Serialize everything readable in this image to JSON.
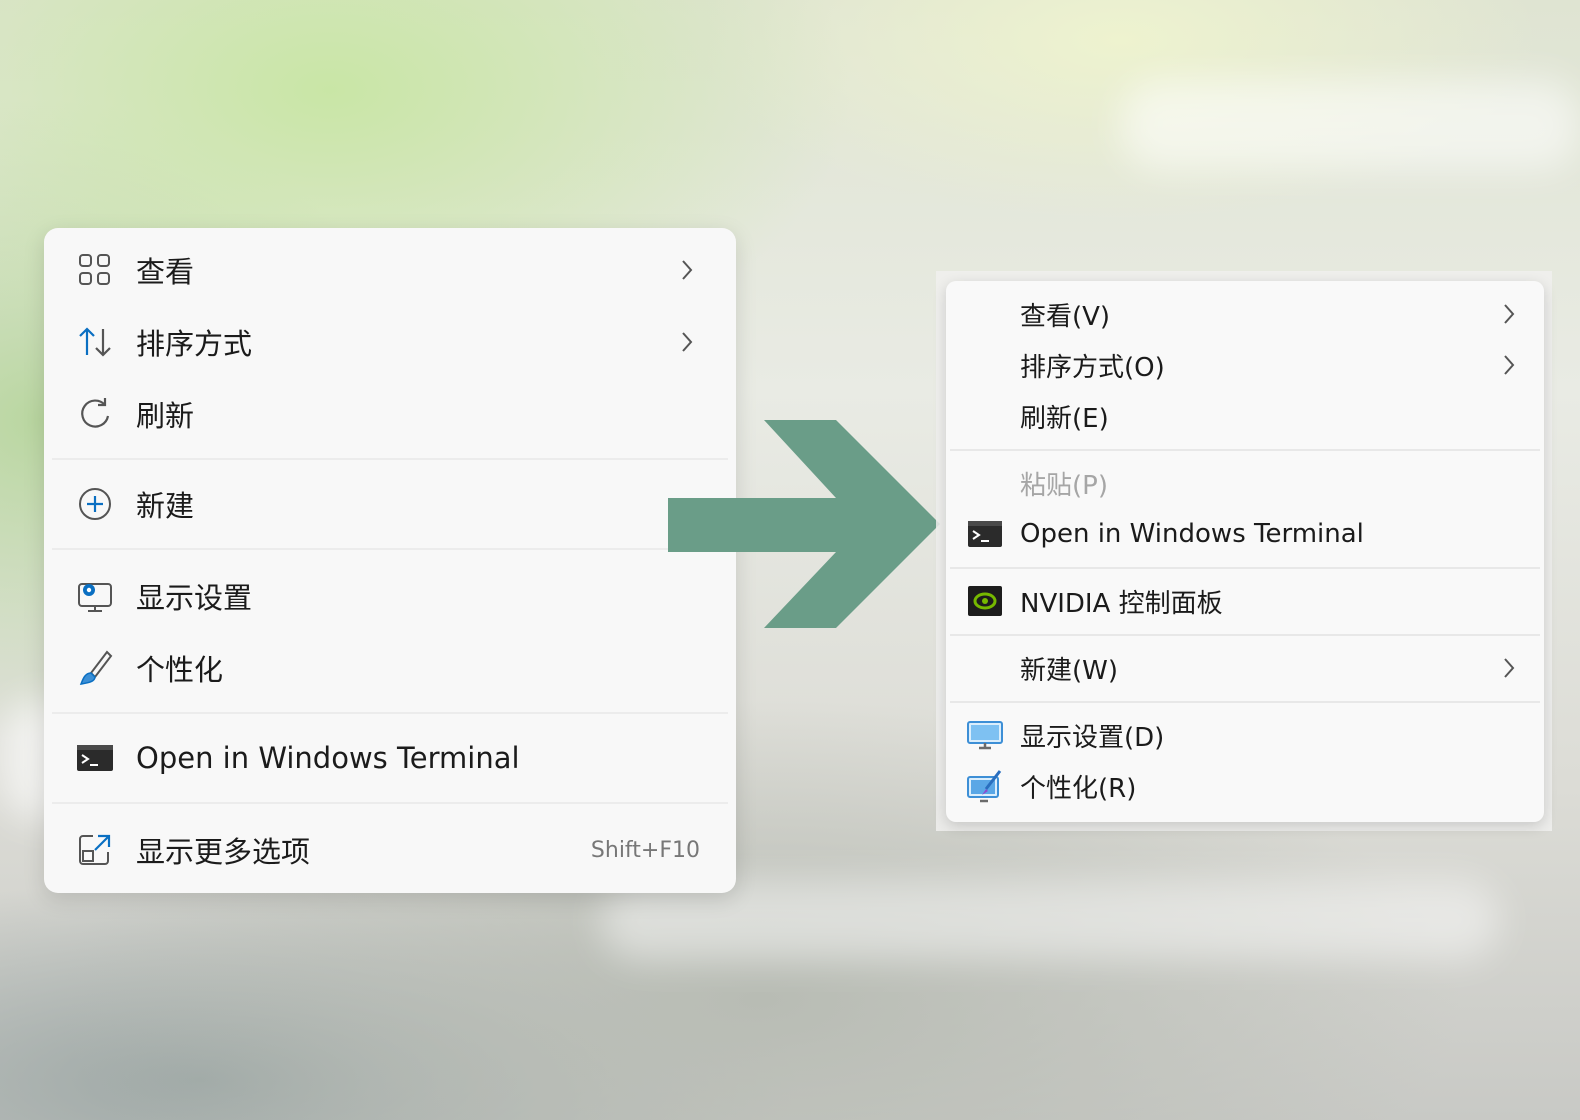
{
  "new_menu": {
    "items": [
      {
        "label": "查看",
        "icon": "grid-icon",
        "has_submenu": true
      },
      {
        "label": "排序方式",
        "icon": "sort-arrows-icon",
        "has_submenu": true
      },
      {
        "label": "刷新",
        "icon": "refresh-icon",
        "has_submenu": false
      },
      {
        "label": "新建",
        "icon": "plus-circle-icon",
        "has_submenu": true
      },
      {
        "label": "显示设置",
        "icon": "display-settings-icon",
        "has_submenu": false
      },
      {
        "label": "个性化",
        "icon": "brush-icon",
        "has_submenu": false
      },
      {
        "label": "Open in Windows Terminal",
        "icon": "terminal-icon",
        "has_submenu": false
      },
      {
        "label": "显示更多选项",
        "icon": "expand-icon",
        "shortcut": "Shift+F10"
      }
    ]
  },
  "arrow": {
    "color": "#6a9d88",
    "direction": "right"
  },
  "old_menu": {
    "items": [
      {
        "label": "查看(V)",
        "has_submenu": true
      },
      {
        "label": "排序方式(O)",
        "has_submenu": true
      },
      {
        "label": "刷新(E)",
        "has_submenu": false
      },
      {
        "label": "粘贴(P)",
        "disabled": true
      },
      {
        "label": "Open in Windows Terminal",
        "icon": "terminal-icon"
      },
      {
        "label": "NVIDIA 控制面板",
        "icon": "nvidia-icon"
      },
      {
        "label": "新建(W)",
        "has_submenu": true
      },
      {
        "label": "显示设置(D)",
        "icon": "monitor-icon"
      },
      {
        "label": "个性化(R)",
        "icon": "personalize-icon"
      }
    ]
  },
  "colors": {
    "accent_blue": "#0a6fc2",
    "menu_background": "#f8f8f8",
    "disabled_text": "#a6a6a6",
    "arrow_green": "#6a9d88"
  }
}
